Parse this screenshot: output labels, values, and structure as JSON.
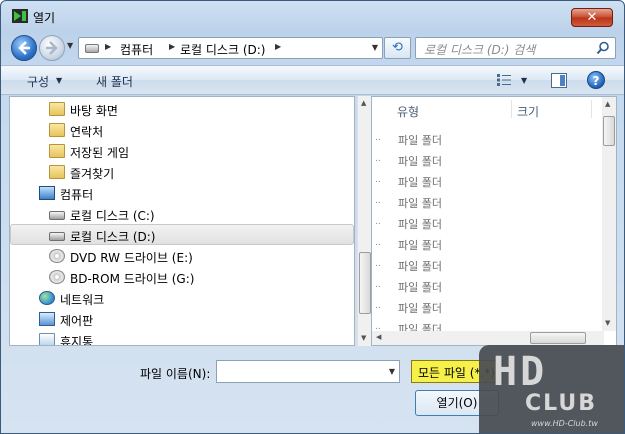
{
  "window": {
    "title": "열기",
    "close_glyph": "✕"
  },
  "nav": {
    "breadcrumbs": [
      "컴퓨터",
      "로컬 디스크 (D:)"
    ],
    "separator": "▶",
    "dropdown": "▼",
    "refresh_glyph": "⟲",
    "search_placeholder": "로컬 디스크 (D:) 검색"
  },
  "toolbar": {
    "organize": "구성",
    "organize_dd": "▼",
    "new_folder": "새 폴더",
    "views_dd": "▼",
    "help": "?"
  },
  "sidebar": {
    "items": [
      {
        "label": "바탕 화면",
        "icon": "folder-icon",
        "selected": false
      },
      {
        "label": "연락처",
        "icon": "folder-icon",
        "selected": false
      },
      {
        "label": "저장된 게임",
        "icon": "folder-icon",
        "selected": false
      },
      {
        "label": "즐겨찾기",
        "icon": "folder-icon",
        "selected": false
      },
      {
        "label": "컴퓨터",
        "icon": "computer-icon",
        "selected": false
      },
      {
        "label": "로컬 디스크 (C:)",
        "icon": "drive-icon",
        "selected": false
      },
      {
        "label": "로컬 디스크 (D:)",
        "icon": "drive-icon",
        "selected": true
      },
      {
        "label": "DVD RW 드라이브 (E:)",
        "icon": "optical-drive-icon",
        "selected": false
      },
      {
        "label": "BD-ROM 드라이브 (G:)",
        "icon": "optical-drive-icon",
        "selected": false
      },
      {
        "label": "네트워크",
        "icon": "network-icon",
        "selected": false
      },
      {
        "label": "제어판",
        "icon": "control-panel-icon",
        "selected": false
      },
      {
        "label": "휴지통",
        "icon": "recycle-bin-icon",
        "selected": false
      }
    ]
  },
  "filelist": {
    "columns": [
      "유형",
      "크기"
    ],
    "rows": [
      "파일 폴더",
      "파일 폴더",
      "파일 폴더",
      "파일 폴더",
      "파일 폴더",
      "파일 폴더",
      "파일 폴더",
      "파일 폴더",
      "파일 폴더",
      "파일 폴더"
    ],
    "row_prefix": ".."
  },
  "footer": {
    "filename_label": "파일 이름(N):",
    "filename_value": "",
    "filetype": "모든 파일 (*.*)",
    "open_button": "열기(O)"
  },
  "watermark": {
    "main": "HD",
    "sub": "CLUB",
    "url": "www.HD-Club.tw"
  },
  "colors": {
    "accent": "#2f72c8",
    "filter_highlight": "#f6f04a",
    "selection": "#e1e1e1"
  }
}
